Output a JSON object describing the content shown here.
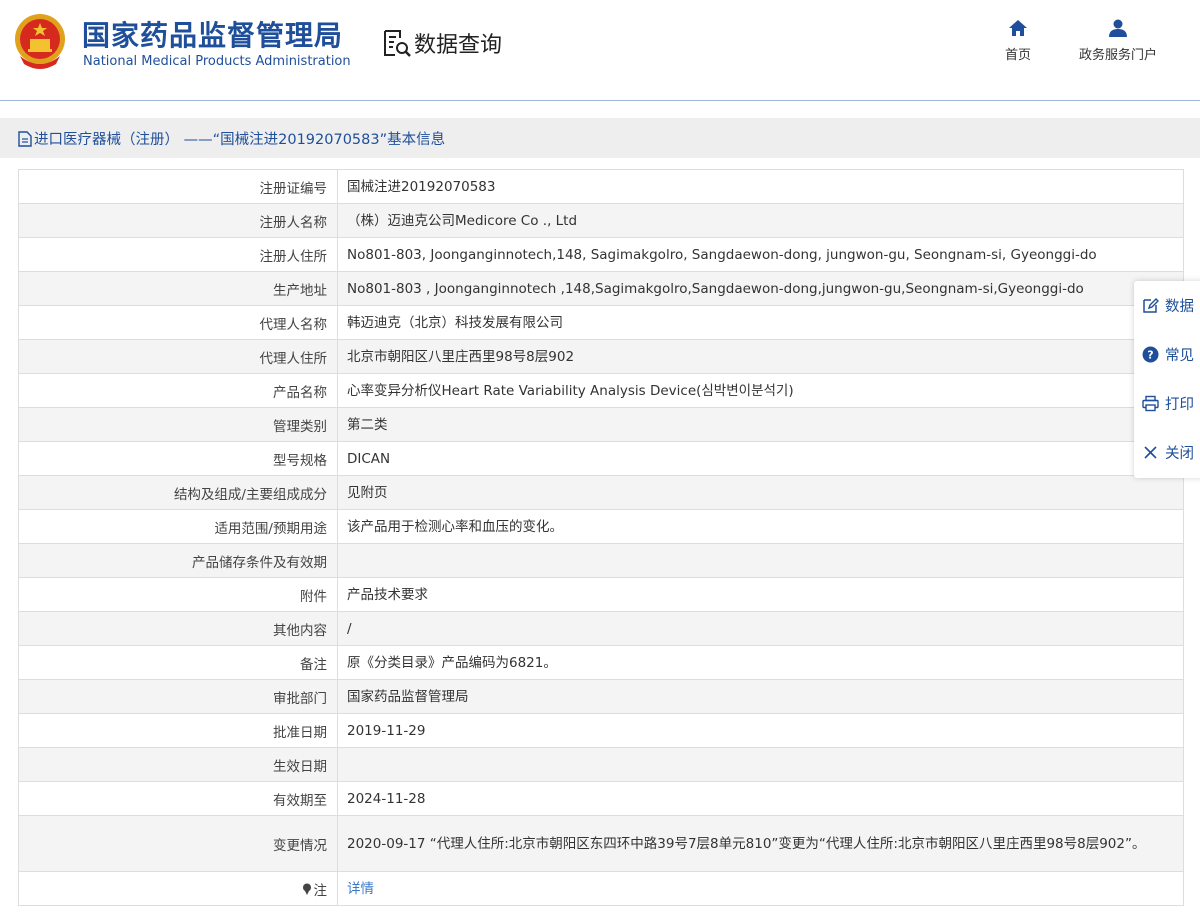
{
  "header": {
    "brand_cn": "国家药品监督管理局",
    "brand_en": "National Medical Products Administration",
    "data_query": "数据查询",
    "nav_home": "首页",
    "nav_gov": "政务服务门户"
  },
  "breadcrumb": "进口医疗器械（注册） ——“国械注进20192070583”基本信息",
  "rows": [
    {
      "label": "注册证编号",
      "value": "国械注进20192070583"
    },
    {
      "label": "注册人名称",
      "value": "（株）迈迪克公司Medicore Co ., Ltd"
    },
    {
      "label": "注册人住所",
      "value": "No801-803, Joonganginnotech,148, Sagimakgolro, Sangdaewon-dong, jungwon-gu, Seongnam-si, Gyeonggi-do"
    },
    {
      "label": "生产地址",
      "value": "No801-803 , Joonganginnotech ,148,Sagimakgolro,Sangdaewon-dong,jungwon-gu,Seongnam-si,Gyeonggi-do"
    },
    {
      "label": "代理人名称",
      "value": "韩迈迪克（北京）科技发展有限公司"
    },
    {
      "label": "代理人住所",
      "value": "北京市朝阳区八里庄西里98号8层902"
    },
    {
      "label": "产品名称",
      "value": "心率变异分析仪Heart Rate Variability Analysis Device(심박변이분석기)"
    },
    {
      "label": "管理类别",
      "value": "第二类"
    },
    {
      "label": "型号规格",
      "value": "DICAN"
    },
    {
      "label": "结构及组成/主要组成成分",
      "value": "见附页"
    },
    {
      "label": "适用范围/预期用途",
      "value": "该产品用于检测心率和血压的变化。"
    },
    {
      "label": "产品储存条件及有效期",
      "value": ""
    },
    {
      "label": "附件",
      "value": "产品技术要求"
    },
    {
      "label": "其他内容",
      "value": "/"
    },
    {
      "label": "备注",
      "value": "原《分类目录》产品编码为6821。"
    },
    {
      "label": "审批部门",
      "value": "国家药品监督管理局"
    },
    {
      "label": "批准日期",
      "value": "2019-11-29"
    },
    {
      "label": "生效日期",
      "value": ""
    },
    {
      "label": "有效期至",
      "value": "2024-11-28"
    },
    {
      "label": "变更情况",
      "value": "2020-09-17 “代理人住所:北京市朝阳区东四环中路39号7层8单元810”变更为“代理人住所:北京市朝阳区八里庄西里98号8层902”。"
    },
    {
      "label": "注",
      "value": "详情"
    }
  ],
  "float_menu": [
    "数据",
    "常见",
    "打印",
    "关闭"
  ],
  "colors": {
    "brand_blue": "#1f4f9b",
    "link_blue": "#3a78c9"
  }
}
